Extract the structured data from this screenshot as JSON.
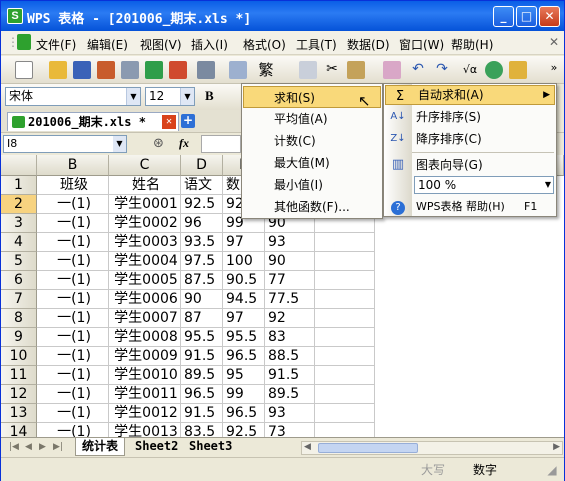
{
  "window": {
    "title": "WPS 表格 - [201006_期末.xls *]",
    "app_icon": "S"
  },
  "menubar": [
    "文件(F)",
    "编辑(E)",
    "视图(V)",
    "插入(I)",
    "格式(O)",
    "工具(T)",
    "数据(D)",
    "窗口(W)",
    "帮助(H)"
  ],
  "toolbar": {
    "font_name": "宋体",
    "font_size": "12",
    "bold": "B"
  },
  "tabs": {
    "document": "201006_期末.xls *",
    "new_tab": "+"
  },
  "formula_bar": {
    "name_box": "I8",
    "fx": "fx"
  },
  "grid": {
    "columns": [
      "B",
      "C",
      "D",
      "E"
    ],
    "rows": [
      {
        "num": "1",
        "cells": [
          "班级",
          "姓名",
          "语文",
          "数"
        ]
      },
      {
        "num": "2",
        "cells": [
          "一(1)",
          "学生0001",
          "92.5",
          "92",
          ""
        ]
      },
      {
        "num": "3",
        "cells": [
          "一(1)",
          "学生0002",
          "96",
          "99",
          "90"
        ]
      },
      {
        "num": "4",
        "cells": [
          "一(1)",
          "学生0003",
          "93.5",
          "97",
          "93"
        ]
      },
      {
        "num": "5",
        "cells": [
          "一(1)",
          "学生0004",
          "97.5",
          "100",
          "90"
        ]
      },
      {
        "num": "6",
        "cells": [
          "一(1)",
          "学生0005",
          "87.5",
          "90.5",
          "77"
        ]
      },
      {
        "num": "7",
        "cells": [
          "一(1)",
          "学生0006",
          "90",
          "94.5",
          "77.5"
        ]
      },
      {
        "num": "8",
        "cells": [
          "一(1)",
          "学生0007",
          "87",
          "97",
          "92"
        ]
      },
      {
        "num": "9",
        "cells": [
          "一(1)",
          "学生0008",
          "95.5",
          "95.5",
          "83"
        ]
      },
      {
        "num": "10",
        "cells": [
          "一(1)",
          "学生0009",
          "91.5",
          "96.5",
          "88.5"
        ]
      },
      {
        "num": "11",
        "cells": [
          "一(1)",
          "学生0010",
          "89.5",
          "95",
          "91.5"
        ]
      },
      {
        "num": "12",
        "cells": [
          "一(1)",
          "学生0011",
          "96.5",
          "99",
          "89.5"
        ]
      },
      {
        "num": "13",
        "cells": [
          "一(1)",
          "学生0012",
          "91.5",
          "96.5",
          "93"
        ]
      },
      {
        "num": "14",
        "cells": [
          "一(1)",
          "学生0013",
          "83.5",
          "92.5",
          "73"
        ]
      }
    ]
  },
  "sheet_tabs": [
    "统计表",
    "Sheet2",
    "Sheet3"
  ],
  "statusbar": {
    "caps": "大写",
    "num": "数字"
  },
  "sum_menu": {
    "items": [
      "求和(S)",
      "平均值(A)",
      "计数(C)",
      "最大值(M)",
      "最小值(I)",
      "其他函数(F)..."
    ]
  },
  "side_menu": {
    "autosum": "自动求和(A)",
    "sort_asc": "升序排序(S)",
    "sort_desc": "降序排序(C)",
    "chart_wizard": "图表向导(G)",
    "zoom": "100 %",
    "help": "WPS表格 帮助(H)",
    "help_key": "F1",
    "sigma": "Σ"
  },
  "colors": {
    "titlebar": "#0a5ee6",
    "menu_highlight": "#f9d97a",
    "row_header_selected": "#f7d380"
  }
}
